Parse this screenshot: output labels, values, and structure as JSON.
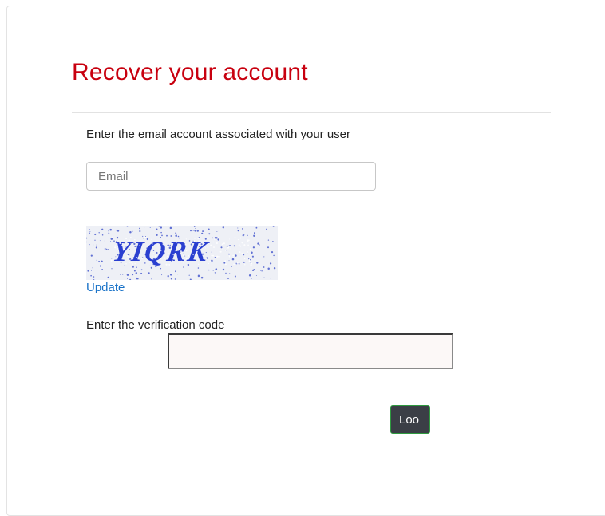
{
  "page": {
    "title": "Recover your account"
  },
  "form": {
    "instruction": "Enter the email account associated with your user",
    "email_placeholder": "Email",
    "email_value": "",
    "captcha_text": "YIQRK",
    "update_label": "Update",
    "verification_label": "Enter the verification code",
    "verification_value": "",
    "lookup_button_label": "Loo"
  },
  "colors": {
    "title": "#c8000f",
    "link": "#1a73c8",
    "button_bg": "#3b3f46",
    "button_border": "#2e9a3f",
    "captcha_text": "#2a3fd0"
  }
}
